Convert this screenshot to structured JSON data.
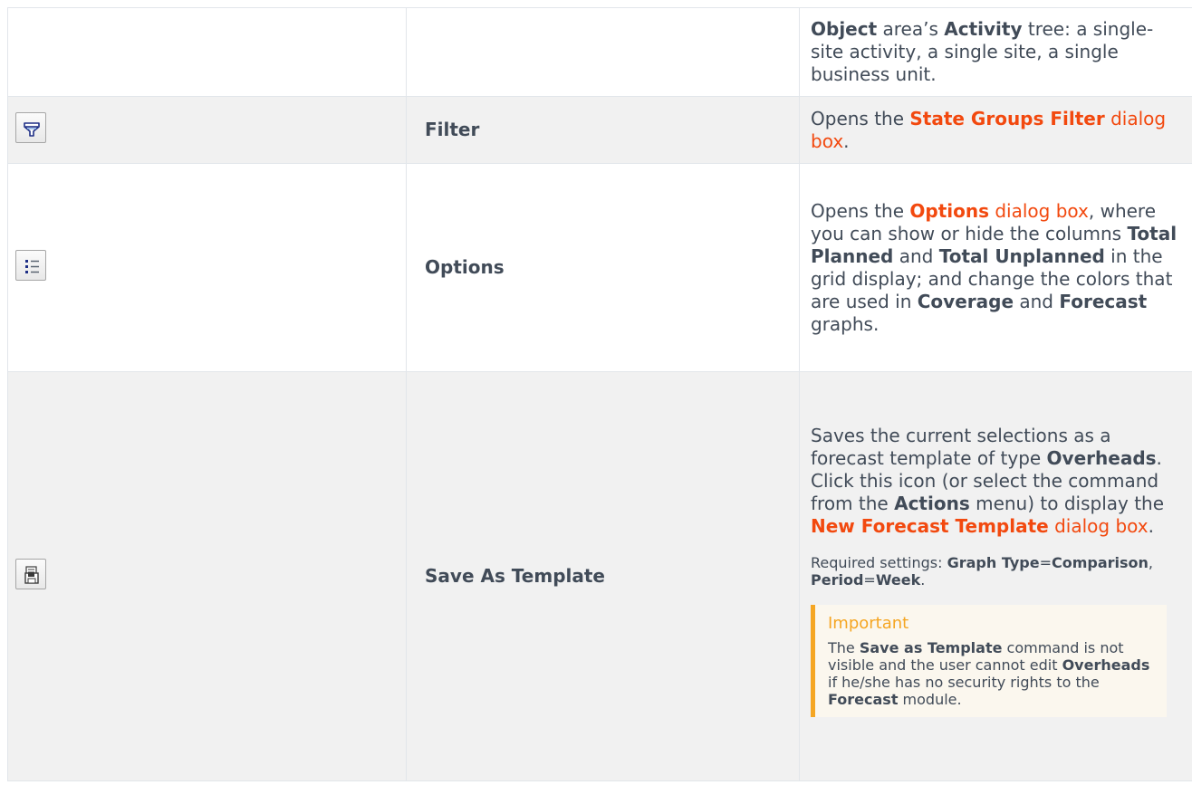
{
  "rows": [
    {
      "desc_parts": [
        "Object",
        " area’s ",
        "Activity",
        " tree: a single-site activity, a single site, a single business unit."
      ]
    },
    {
      "name": "Filter",
      "icon": "filter-icon",
      "desc_parts": [
        "Opens the ",
        "State Groups Filter",
        " dialog box",
        "."
      ]
    },
    {
      "name": "Options",
      "icon": "list-icon",
      "desc_parts": [
        "Opens the ",
        "Options",
        " dialog box",
        ", where you can show or hide the columns ",
        "Total Planned",
        " and ",
        "Total Unplanned",
        " in the grid display; and change the colors that are used in ",
        "Coverage",
        " and ",
        "Forecast",
        " graphs."
      ]
    },
    {
      "name": "Save As Template",
      "icon": "save-template-icon",
      "desc_parts": [
        "Saves the current selections as a forecast template of type ",
        "Overheads",
        ". Click this icon (or select the command from the ",
        "Actions",
        " menu) to display the ",
        "New Forecast Template",
        " dialog box",
        "."
      ],
      "required_parts": [
        "Required settings: ",
        "Graph Type",
        "=",
        "Comparison",
        ", ",
        "Period",
        "=",
        "Week",
        "."
      ],
      "note": {
        "title": "Important",
        "body_parts": [
          "The ",
          "Save as Template",
          " command is not visible and the user cannot edit ",
          "Overheads",
          " if he/she has no security rights to the ",
          "Forecast",
          " module."
        ]
      }
    }
  ],
  "colors": {
    "text": "#414b58",
    "link": "#f2490f",
    "note_accent": "#f5a623",
    "note_bg": "#fbf7ee",
    "row_alt": "#f1f1f1"
  }
}
